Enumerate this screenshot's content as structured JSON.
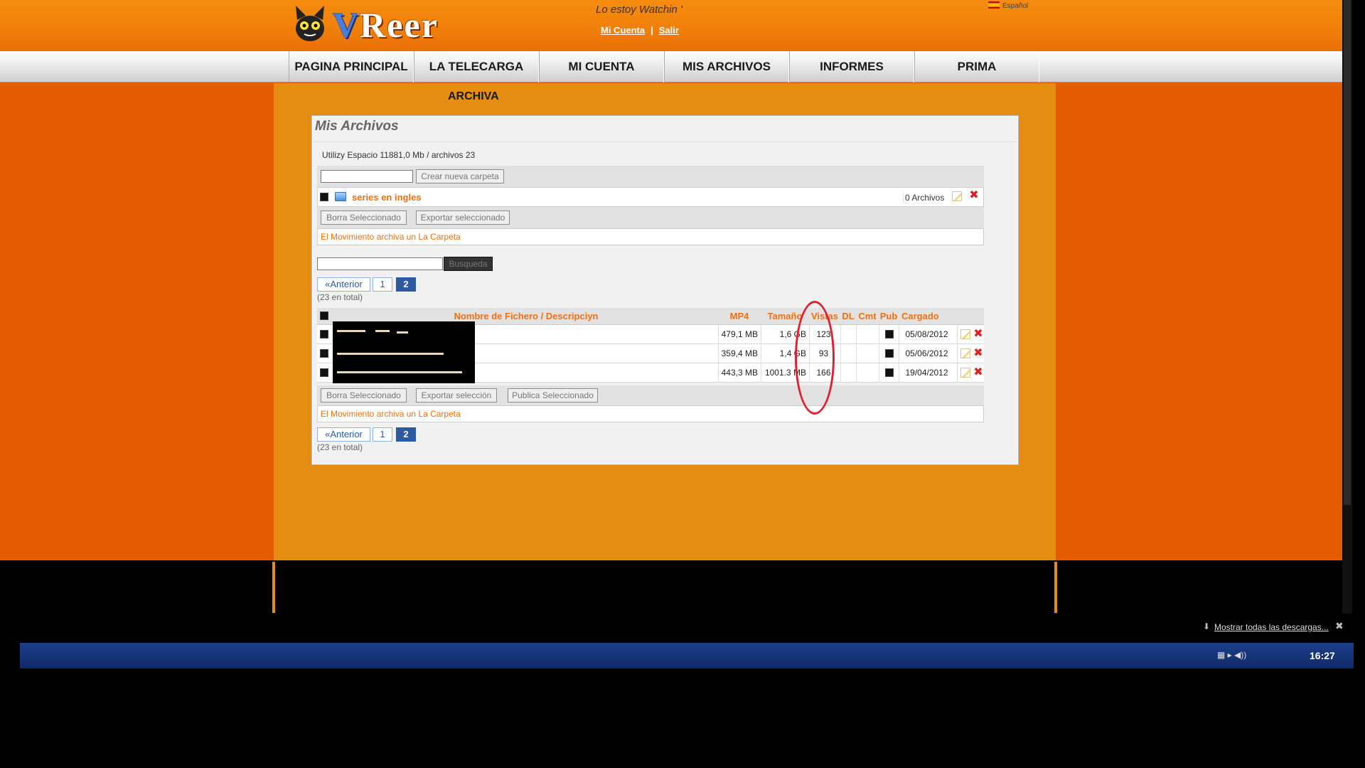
{
  "header": {
    "logo_text": "VReer",
    "tagline": "Lo estoy Watchin '",
    "links": {
      "account": "Mi Cuenta",
      "sep": "|",
      "logout": "Salir"
    },
    "language": "Español"
  },
  "nav": {
    "items": [
      "PAGINA PRINCIPAL",
      "LA TELECARGA",
      "MI CUENTA",
      "MIS ARCHIVOS",
      "INFORMES",
      "PRIMA"
    ],
    "sub_item": "ARCHIVA"
  },
  "panel": {
    "title": "Mis Archivos",
    "usage": "Utilizy Espacio 11881,0 Mb / archivos 23",
    "create_folder_button": "Crear nueva carpeta",
    "folder": {
      "name": "series en ingles",
      "files": "0 Archivos"
    },
    "folder_actions": {
      "delete": "Borra Seleccionado",
      "export": "Exportar seleccionado"
    },
    "move_link": "El Movimiento archiva un La Carpeta",
    "search_button": "Busqueda",
    "pager": {
      "prev": "«Anterior",
      "pages": [
        "1",
        "2"
      ],
      "current": "2",
      "total": "(23 en total)"
    },
    "table": {
      "headers": {
        "name": "Nombre de Fichero / Descripciyn",
        "mp4": "MP4",
        "size": "Tamaño",
        "views": "Vistas",
        "dl": "DL",
        "cmt": "Cmt",
        "pub": "Pub",
        "uploaded": "Cargado"
      },
      "rows": [
        {
          "mp4": "479,1 MB",
          "size": "1,6 GB",
          "views": "123",
          "uploaded": "05/08/2012"
        },
        {
          "mp4": "359,4 MB",
          "size": "1,4 GB",
          "views": "93",
          "uploaded": "05/06/2012"
        },
        {
          "mp4": "443,3 MB",
          "size": "1001.3 MB",
          "views": "166",
          "uploaded": "19/04/2012"
        }
      ]
    },
    "file_actions": {
      "delete": "Borra Seleccionado",
      "export": "Exportar selección",
      "publish": "Publica Seleccionado"
    }
  },
  "downloads_bar": {
    "show_all": "Mostrar todas las descargas..."
  },
  "taskbar": {
    "clock": "16:27"
  },
  "colors": {
    "accent": "#f07010",
    "page_bg": "#e55b00",
    "column_bg": "#e48d10",
    "highlight_circle": "#e02030"
  }
}
